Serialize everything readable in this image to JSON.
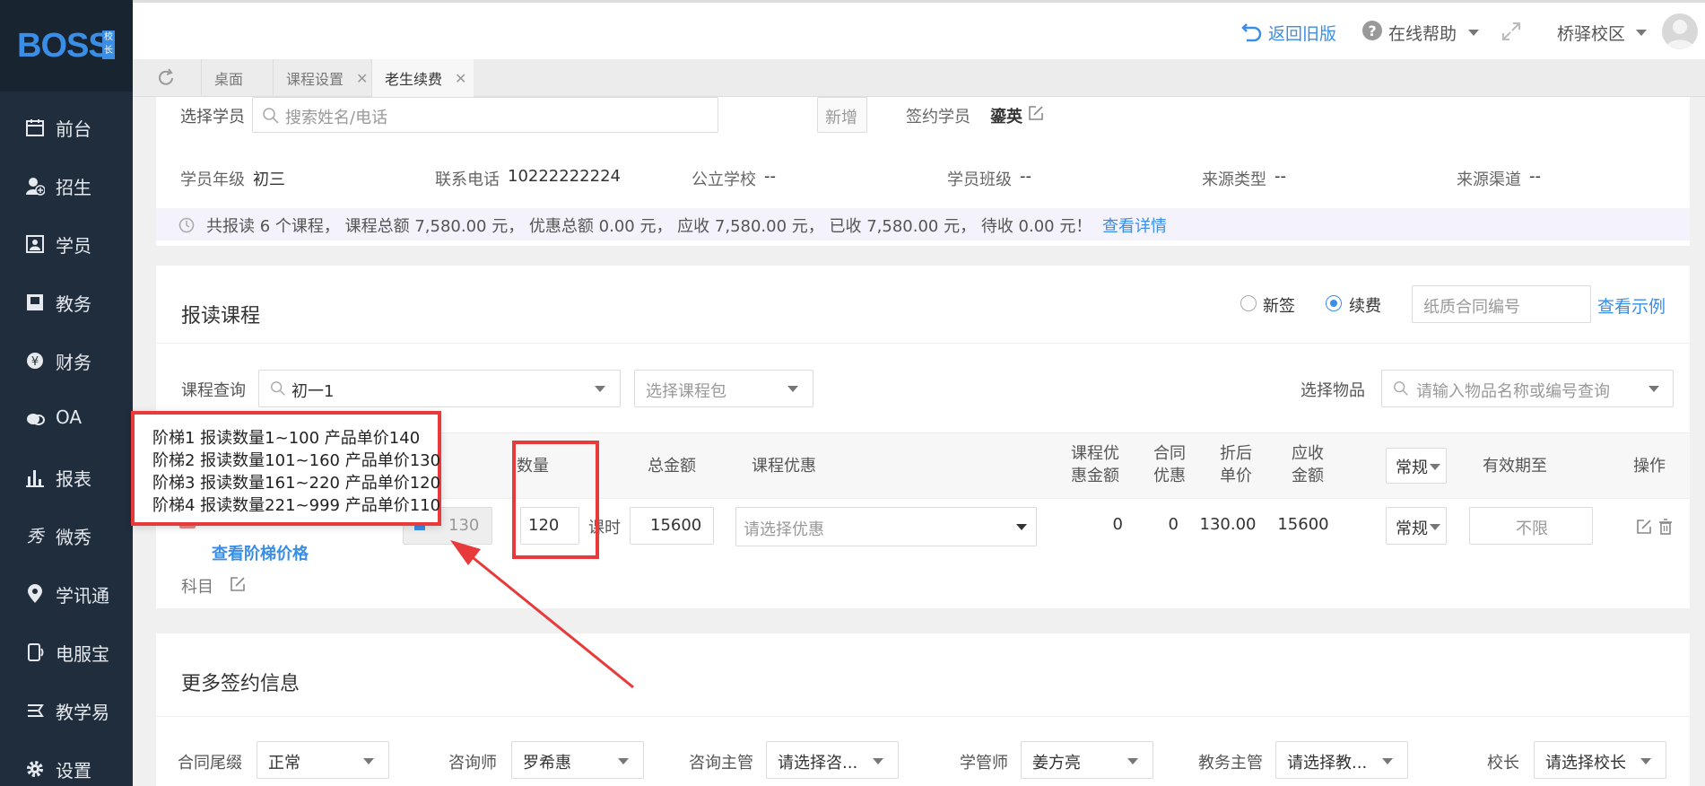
{
  "app": {
    "logo_text": "BOSS",
    "logo_badge": "校长"
  },
  "sidebar": {
    "items": [
      {
        "label": "前台",
        "icon": "calendar-icon"
      },
      {
        "label": "招生",
        "icon": "add-user-icon"
      },
      {
        "label": "学员",
        "icon": "id-card-icon"
      },
      {
        "label": "教务",
        "icon": "book-icon"
      },
      {
        "label": "财务",
        "icon": "yen-icon"
      },
      {
        "label": "OA",
        "icon": "chat-icon"
      },
      {
        "label": "报表",
        "icon": "bar-chart-icon"
      },
      {
        "label": "微秀",
        "icon": "xiu-icon"
      },
      {
        "label": "学讯通",
        "icon": "location-pin-icon"
      },
      {
        "label": "电服宝",
        "icon": "phone-icon"
      },
      {
        "label": "教学易",
        "icon": "teach-icon"
      },
      {
        "label": "设置",
        "icon": "gear-icon"
      }
    ]
  },
  "header": {
    "back_label": "返回旧版",
    "help_label": "在线帮助",
    "campus_label": "桥驿校区"
  },
  "tabs": [
    {
      "label": "桌面"
    },
    {
      "label": "课程设置"
    },
    {
      "label": "老生续费"
    }
  ],
  "student": {
    "select_label": "选择学员",
    "search_placeholder": "搜索姓名/电话",
    "add_label": "新增",
    "signed_label": "签约学员",
    "signed_name": "鎏英",
    "grade_label": "学员年级",
    "grade_value": "初三",
    "phone_label": "联系电话",
    "phone_value": "10222222224",
    "school_label": "公立学校",
    "school_value": "--",
    "class_label": "学员班级",
    "class_value": "--",
    "source_type_label": "来源类型",
    "source_type_value": "--",
    "source_channel_label": "来源渠道",
    "source_channel_value": "--",
    "summary": "共报读 6 个课程， 课程总额 7,580.00 元， 优惠总额 0.00 元， 应收 7,580.00 元， 已收 7,580.00 元， 待收 0.00 元！",
    "detail_link": "查看详情"
  },
  "course": {
    "title": "报读课程",
    "radio_new": "新签",
    "radio_renew": "续费",
    "contract_placeholder": "纸质合同编号",
    "example_link": "查看示例",
    "query_label": "课程查询",
    "query_value": "初一1",
    "package_placeholder": "选择课程包",
    "item_label": "选择物品",
    "item_placeholder": "请输入物品名称或编号查询",
    "columns": {
      "qty": "数量",
      "total": "总金额",
      "discount": "课程优惠",
      "disc_amount": "课程优惠金额",
      "contract_disc": "合同优惠",
      "unit_after": "折后单价",
      "receivable": "应收金额",
      "type": "常规",
      "valid_until": "有效期至",
      "action": "操作"
    },
    "row": {
      "price": "130",
      "qty": "120",
      "unit": "课时",
      "total": "15600",
      "discount_placeholder": "请选择优惠",
      "disc_amount": "0",
      "contract_disc": "0",
      "unit_after": "130.00",
      "receivable": "15600",
      "type": "常规",
      "valid_until": "不限",
      "tier_link": "查看阶梯价格",
      "subject_label": "科目"
    },
    "tier_popup": [
      "阶梯1 报读数量1~100 产品单价140",
      "阶梯2 报读数量101~160 产品单价130",
      "阶梯3 报读数量161~220 产品单价120",
      "阶梯4 报读数量221~999 产品单价110"
    ]
  },
  "more": {
    "title": "更多签约信息",
    "fields": [
      {
        "label": "合同尾缀",
        "value": "正常"
      },
      {
        "label": "咨询师",
        "value": "罗希惠"
      },
      {
        "label": "咨询主管",
        "value": "请选择咨..."
      },
      {
        "label": "学管师",
        "value": "姜方亮"
      },
      {
        "label": "教务主管",
        "value": "请选择教..."
      },
      {
        "label": "校长",
        "value": "请选择校长"
      }
    ]
  },
  "colors": {
    "sidebar": "#1f2d3d",
    "accent": "#3a8ee6",
    "annotation": "#e83a3a"
  }
}
